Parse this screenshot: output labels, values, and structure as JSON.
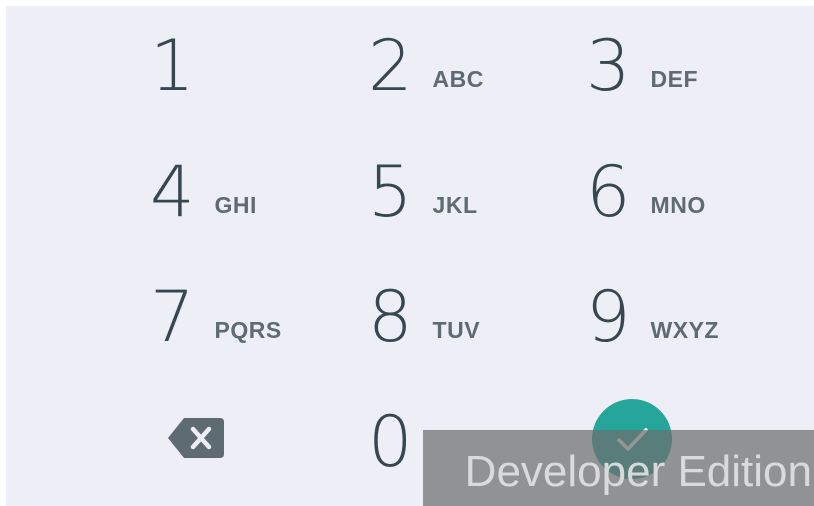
{
  "keypad": {
    "keys": [
      {
        "digit": "1",
        "letters": ""
      },
      {
        "digit": "2",
        "letters": "ABC"
      },
      {
        "digit": "3",
        "letters": "DEF"
      },
      {
        "digit": "4",
        "letters": "GHI"
      },
      {
        "digit": "5",
        "letters": "JKL"
      },
      {
        "digit": "6",
        "letters": "MNO"
      },
      {
        "digit": "7",
        "letters": "PQRS"
      },
      {
        "digit": "8",
        "letters": "TUV"
      },
      {
        "digit": "9",
        "letters": "WXYZ"
      },
      {
        "digit": "0",
        "letters": ""
      }
    ],
    "backspace_icon": "backspace-icon",
    "confirm_icon": "checkmark-icon"
  },
  "colors": {
    "background": "#eeeff6",
    "digit": "#37474f",
    "letters": "#5f6b72",
    "accent": "#26a69a"
  },
  "watermark": {
    "text": "Developer Edition"
  }
}
